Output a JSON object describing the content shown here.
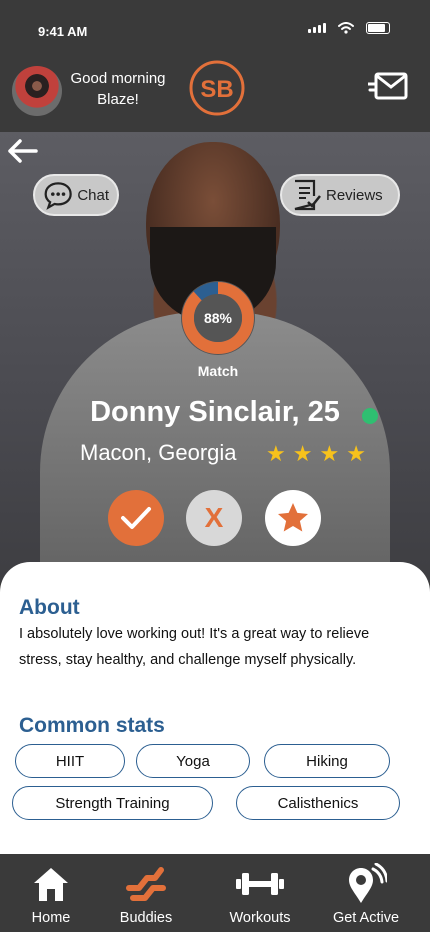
{
  "status": {
    "time": "9:41 AM"
  },
  "header": {
    "greeting": "Good morning Blaze!",
    "logo_text": "SB",
    "brand_color": "#e2703a"
  },
  "profile": {
    "chat_label": "Chat",
    "reviews_label": "Reviews",
    "match_percent": "88%",
    "match_value": 0.88,
    "match_label": "Match",
    "name": "Donny Sinclair, 25",
    "location": "Macon,  Georgia",
    "rating": 4,
    "online_color": "#2fbf71",
    "reject_label": "X"
  },
  "about": {
    "title": "About",
    "text": "I absolutely love working out! It's a great way to relieve stress, stay healthy, and challenge myself physically."
  },
  "stats": {
    "title": "Common stats",
    "items": [
      "HIIT",
      "Yoga",
      "Hiking",
      "Strength Training",
      "Calisthenics"
    ]
  },
  "tabs": [
    {
      "label": "Home",
      "icon": "home-icon"
    },
    {
      "label": "Buddies",
      "icon": "buddies-icon",
      "active": true
    },
    {
      "label": "Workouts",
      "icon": "dumbbell-icon"
    },
    {
      "label": "Get Active",
      "icon": "location-pin-icon"
    }
  ],
  "colors": {
    "accent": "#e2703a",
    "heading": "#2c5f91",
    "star": "#f7c21c",
    "dark": "#3a3a3a"
  }
}
